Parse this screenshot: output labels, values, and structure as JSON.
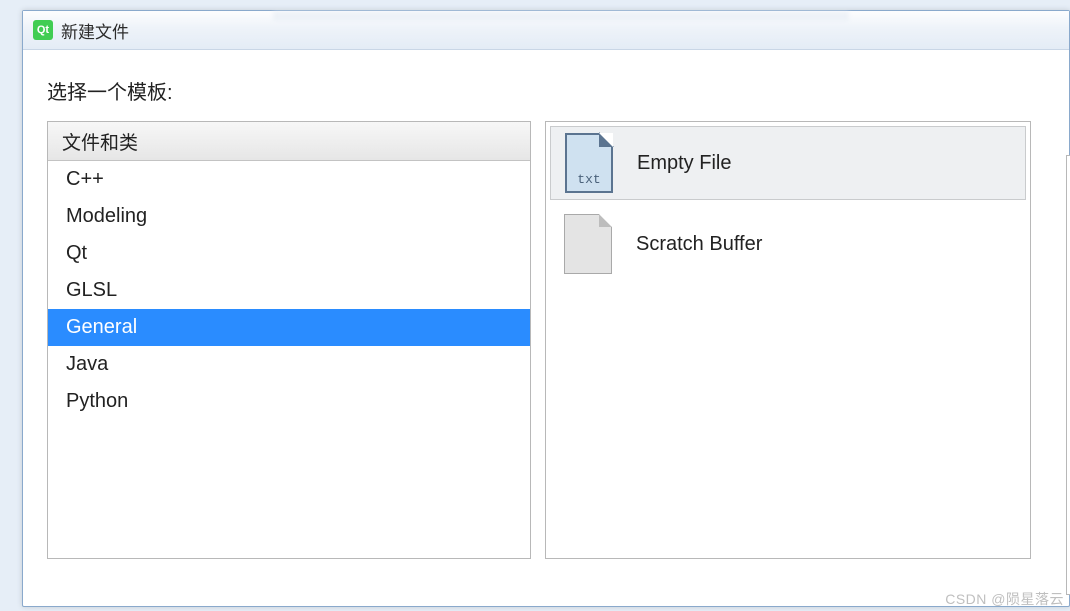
{
  "window": {
    "title": "新建文件",
    "icon_text": "Qt"
  },
  "prompt": "选择一个模板:",
  "category_header": "文件和类",
  "categories": [
    {
      "label": "C++",
      "selected": false
    },
    {
      "label": "Modeling",
      "selected": false
    },
    {
      "label": "Qt",
      "selected": false
    },
    {
      "label": "GLSL",
      "selected": false
    },
    {
      "label": "General",
      "selected": true
    },
    {
      "label": "Java",
      "selected": false
    },
    {
      "label": "Python",
      "selected": false
    }
  ],
  "templates": [
    {
      "label": "Empty File",
      "icon": "txt",
      "icon_label": "txt",
      "selected": true
    },
    {
      "label": "Scratch Buffer",
      "icon": "plain",
      "icon_label": "",
      "selected": false
    }
  ],
  "watermark": "CSDN @陨星落云"
}
